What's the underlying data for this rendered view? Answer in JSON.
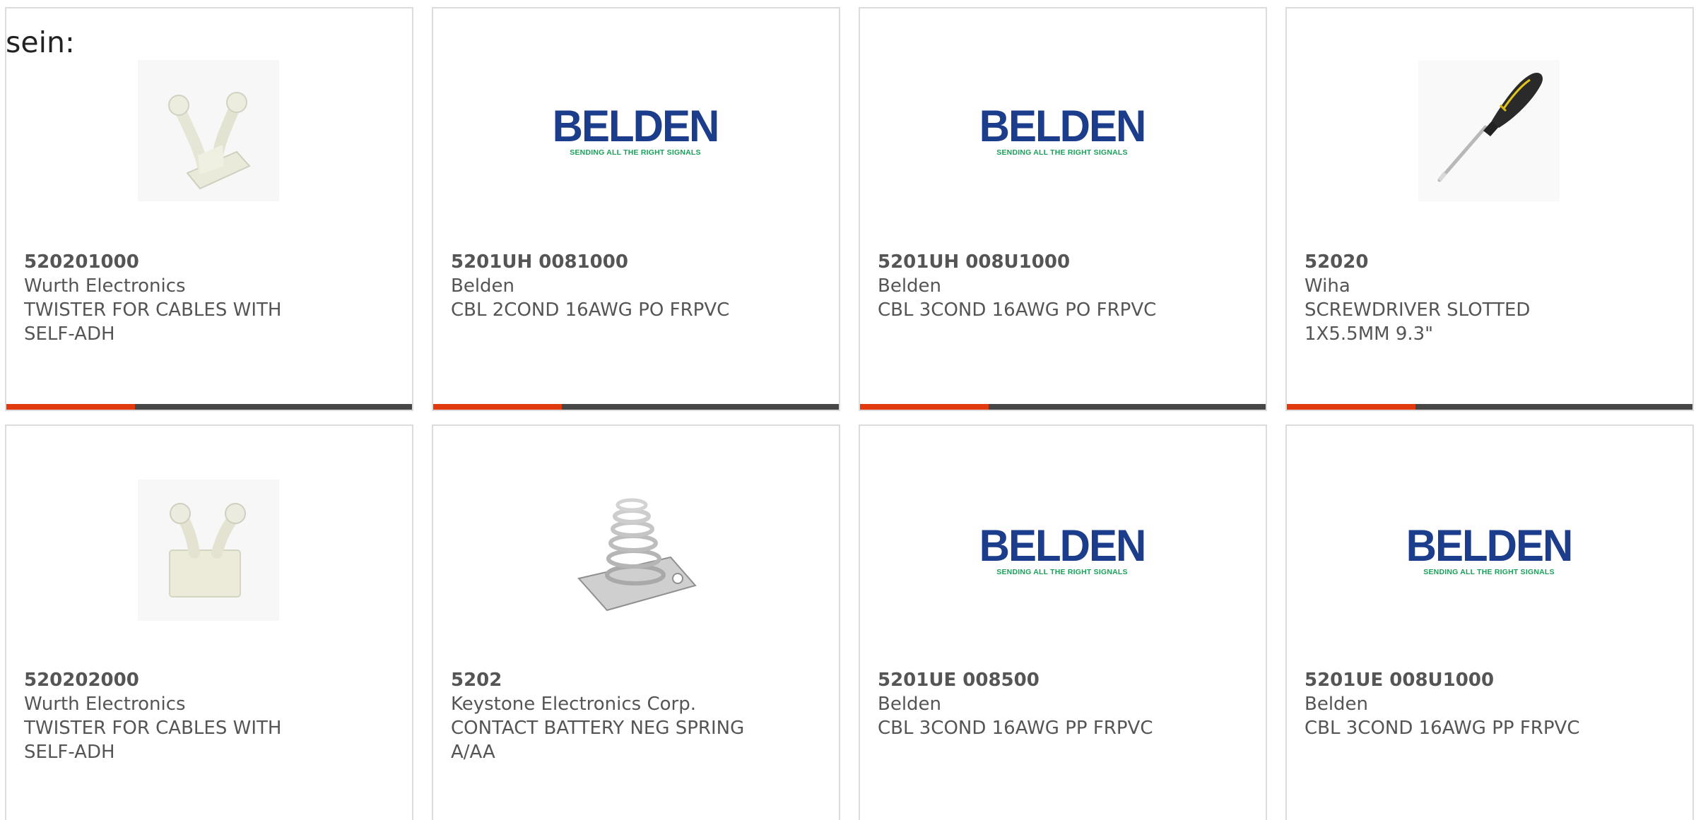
{
  "intro_text": "sein:",
  "brand": {
    "accent_color": "#e03a0e",
    "bar_color": "#474747",
    "belden_logo_word": "BELDEN",
    "belden_logo_tagline": "SENDING ALL THE RIGHT SIGNALS"
  },
  "products": [
    {
      "part": "520201000",
      "manufacturer": "Wurth Electronics",
      "description": "TWISTER FOR CABLES WITH SELF-ADH",
      "image": "cable-twister-clip-icon"
    },
    {
      "part": "5201UH 0081000",
      "manufacturer": "Belden",
      "description": "CBL 2COND 16AWG PO FRPVC",
      "image": "belden-logo"
    },
    {
      "part": "5201UH 008U1000",
      "manufacturer": "Belden",
      "description": "CBL 3COND 16AWG PO FRPVC",
      "image": "belden-logo"
    },
    {
      "part": "52020",
      "manufacturer": "Wiha",
      "description": "SCREWDRIVER SLOTTED 1X5.5MM 9.3\"",
      "image": "screwdriver-icon"
    },
    {
      "part": "520202000",
      "manufacturer": "Wurth Electronics",
      "description": "TWISTER FOR CABLES WITH SELF-ADH",
      "image": "cable-twister-clip-icon"
    },
    {
      "part": "5202",
      "manufacturer": "Keystone Electronics Corp.",
      "description": "CONTACT BATTERY NEG SPRING A/AA",
      "image": "battery-spring-contact-icon"
    },
    {
      "part": "5201UE 008500",
      "manufacturer": "Belden",
      "description": "CBL 3COND 16AWG PP FRPVC",
      "image": "belden-logo"
    },
    {
      "part": "5201UE 008U1000",
      "manufacturer": "Belden",
      "description": "CBL 3COND 16AWG PP FRPVC",
      "image": "belden-logo"
    }
  ]
}
